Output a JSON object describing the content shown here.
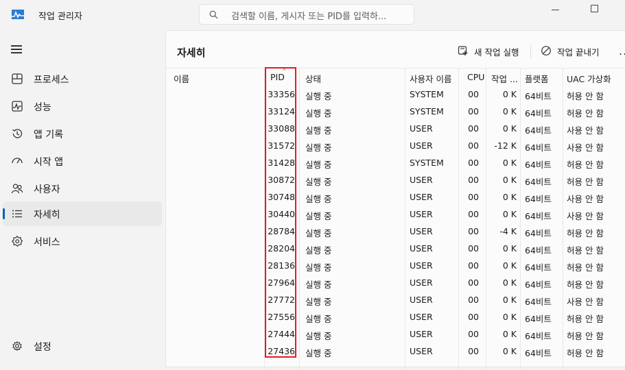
{
  "app": {
    "title": "작업 관리자"
  },
  "search": {
    "placeholder": "검색할 이름, 게시자 또는 PID를 입력하..."
  },
  "sidebar": {
    "items": [
      {
        "label": "프로세스",
        "icon": "processes-icon"
      },
      {
        "label": "성능",
        "icon": "performance-icon"
      },
      {
        "label": "앱 기록",
        "icon": "app-history-icon"
      },
      {
        "label": "시작 앱",
        "icon": "startup-apps-icon"
      },
      {
        "label": "사용자",
        "icon": "users-icon"
      },
      {
        "label": "자세히",
        "icon": "details-icon",
        "active": true
      },
      {
        "label": "서비스",
        "icon": "services-icon"
      }
    ],
    "settings_label": "설정"
  },
  "page": {
    "title": "자세히",
    "run_new_task": "새 작업 실행",
    "end_task": "작업 끝내기",
    "more": "..."
  },
  "table": {
    "headers": {
      "name": "이름",
      "pid": "PID",
      "status": "상태",
      "user": "사용자 이름",
      "cpu": "CPU",
      "memory": "작업 ...",
      "platform": "플랫폼",
      "uac": "UAC 가상화"
    },
    "rows": [
      {
        "pid": "33356",
        "status": "실행 중",
        "user": "SYSTEM",
        "cpu": "00",
        "memory": "0 K",
        "platform": "64비트",
        "uac": "허용 안 함"
      },
      {
        "pid": "33124",
        "status": "실행 중",
        "user": "SYSTEM",
        "cpu": "00",
        "memory": "0 K",
        "platform": "64비트",
        "uac": "허용 안 함"
      },
      {
        "pid": "33088",
        "status": "실행 중",
        "user": "USER",
        "cpu": "00",
        "memory": "0 K",
        "platform": "64비트",
        "uac": "사용 안 함"
      },
      {
        "pid": "31572",
        "status": "실행 중",
        "user": "USER",
        "cpu": "00",
        "memory": "-12 K",
        "platform": "64비트",
        "uac": "사용 안 함"
      },
      {
        "pid": "31428",
        "status": "실행 중",
        "user": "SYSTEM",
        "cpu": "00",
        "memory": "0 K",
        "platform": "64비트",
        "uac": "허용 안 함"
      },
      {
        "pid": "30872",
        "status": "실행 중",
        "user": "USER",
        "cpu": "00",
        "memory": "0 K",
        "platform": "64비트",
        "uac": "허용 안 함"
      },
      {
        "pid": "30748",
        "status": "실행 중",
        "user": "USER",
        "cpu": "00",
        "memory": "0 K",
        "platform": "64비트",
        "uac": "사용 안 함"
      },
      {
        "pid": "30440",
        "status": "실행 중",
        "user": "USER",
        "cpu": "00",
        "memory": "0 K",
        "platform": "64비트",
        "uac": "사용 안 함"
      },
      {
        "pid": "28784",
        "status": "실행 중",
        "user": "USER",
        "cpu": "00",
        "memory": "-4 K",
        "platform": "64비트",
        "uac": "허용 안 함"
      },
      {
        "pid": "28204",
        "status": "실행 중",
        "user": "USER",
        "cpu": "00",
        "memory": "0 K",
        "platform": "64비트",
        "uac": "허용 안 함"
      },
      {
        "pid": "28136",
        "status": "실행 중",
        "user": "USER",
        "cpu": "00",
        "memory": "0 K",
        "platform": "64비트",
        "uac": "허용 안 함"
      },
      {
        "pid": "27964",
        "status": "실행 중",
        "user": "USER",
        "cpu": "00",
        "memory": "0 K",
        "platform": "64비트",
        "uac": "허용 안 함"
      },
      {
        "pid": "27772",
        "status": "실행 중",
        "user": "USER",
        "cpu": "00",
        "memory": "0 K",
        "platform": "64비트",
        "uac": "사용 안 함"
      },
      {
        "pid": "27556",
        "status": "실행 중",
        "user": "USER",
        "cpu": "00",
        "memory": "0 K",
        "platform": "64비트",
        "uac": "허용 안 함"
      },
      {
        "pid": "27444",
        "status": "실행 중",
        "user": "USER",
        "cpu": "00",
        "memory": "0 K",
        "platform": "64비트",
        "uac": "허용 안 함"
      },
      {
        "pid": "27436",
        "status": "실행 중",
        "user": "USER",
        "cpu": "00",
        "memory": "0 K",
        "platform": "64비트",
        "uac": "허용 안 함"
      }
    ]
  },
  "colors": {
    "accent": "#005fb8",
    "highlight_box": "#e21b23"
  }
}
